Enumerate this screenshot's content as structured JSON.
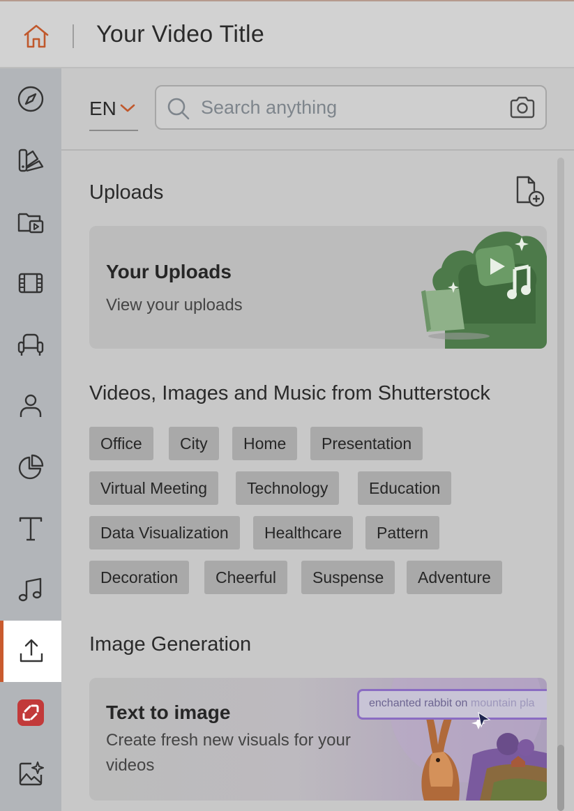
{
  "topbar": {
    "title": "Your Video Title",
    "accent_color": "#c95a2e",
    "home_icon": "home-icon"
  },
  "rail": {
    "items": [
      {
        "name": "explore",
        "icon": "compass-icon",
        "active": false
      },
      {
        "name": "brand-kit",
        "icon": "palette-icon",
        "active": false
      },
      {
        "name": "media-folder",
        "icon": "folder-play-icon",
        "active": false
      },
      {
        "name": "video",
        "icon": "film-icon",
        "active": false
      },
      {
        "name": "props",
        "icon": "armchair-icon",
        "active": false
      },
      {
        "name": "characters",
        "icon": "person-icon",
        "active": false
      },
      {
        "name": "charts",
        "icon": "pie-chart-icon",
        "active": false
      },
      {
        "name": "text",
        "icon": "text-icon",
        "active": false
      },
      {
        "name": "audio",
        "icon": "music-note-icon",
        "active": false
      },
      {
        "name": "uploads",
        "icon": "upload-icon",
        "active": true
      },
      {
        "name": "app",
        "icon": "red-app-icon",
        "active": false
      },
      {
        "name": "ai-image",
        "icon": "image-sparkle-icon",
        "active": false
      }
    ]
  },
  "panel": {
    "language": "EN",
    "search_placeholder": "Search anything",
    "uploads_title": "Uploads",
    "uploads_card": {
      "title": "Your Uploads",
      "subtitle": "View your uploads"
    },
    "shutterstock_title": "Videos, Images and Music from Shutterstock",
    "tags": [
      "Office",
      "City",
      "Home",
      "Presentation",
      "Virtual Meeting",
      "Technology",
      "Education",
      "Data Visualization",
      "Healthcare",
      "Pattern",
      "Decoration",
      "Cheerful",
      "Suspense",
      "Adventure"
    ],
    "image_generation_title": "Image Generation",
    "gen_card": {
      "title": "Text to image",
      "subtitle": "Create fresh new visuals for your videos",
      "prompt_text_dark": "enchanted rabbit on",
      "prompt_text_faded": " mountain pla"
    }
  }
}
